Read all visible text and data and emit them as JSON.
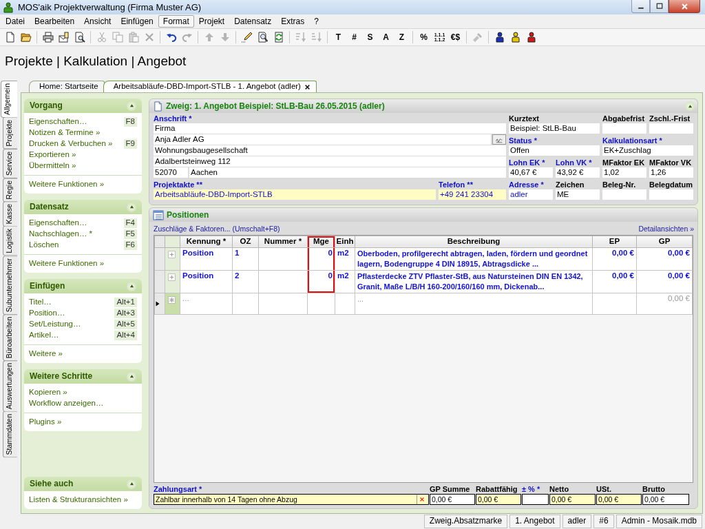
{
  "window": {
    "title": "MOS'aik Projektverwaltung (Firma Muster AG)"
  },
  "menu": [
    {
      "label": "Datei",
      "selected": false
    },
    {
      "label": "Bearbeiten",
      "selected": false
    },
    {
      "label": "Ansicht",
      "selected": false
    },
    {
      "label": "Einfügen",
      "selected": false
    },
    {
      "label": "Format",
      "selected": true
    },
    {
      "label": "Projekt",
      "selected": false
    },
    {
      "label": "Datensatz",
      "selected": false
    },
    {
      "label": "Extras",
      "selected": false
    },
    {
      "label": "?",
      "selected": false
    }
  ],
  "toolbar": [
    [
      {
        "kind": "icon",
        "disabled": false
      },
      {
        "kind": "icon",
        "disabled": false
      }
    ],
    [
      {
        "kind": "icon",
        "disabled": false
      },
      {
        "kind": "icon",
        "disabled": false
      },
      {
        "kind": "icon",
        "disabled": false
      }
    ],
    [
      {
        "kind": "icon",
        "disabled": true
      },
      {
        "kind": "icon",
        "disabled": true
      },
      {
        "kind": "icon",
        "disabled": true
      },
      {
        "kind": "icon",
        "disabled": true
      }
    ],
    [
      {
        "kind": "icon",
        "disabled": false
      },
      {
        "kind": "icon",
        "disabled": true
      }
    ],
    [
      {
        "kind": "icon",
        "disabled": true
      },
      {
        "kind": "icon",
        "disabled": true
      }
    ],
    [
      {
        "kind": "icon",
        "disabled": false
      },
      {
        "kind": "icon",
        "disabled": false
      },
      {
        "kind": "icon",
        "disabled": false
      }
    ],
    [
      {
        "kind": "icon",
        "disabled": true
      },
      {
        "kind": "icon",
        "disabled": true
      }
    ],
    [
      {
        "kind": "glyph",
        "glyph": "T",
        "disabled": false
      },
      {
        "kind": "glyph",
        "glyph": "#",
        "disabled": false
      },
      {
        "kind": "glyph",
        "glyph": "S",
        "disabled": false
      },
      {
        "kind": "glyph",
        "glyph": "A",
        "disabled": false
      },
      {
        "kind": "glyph",
        "glyph": "Z",
        "disabled": false
      }
    ],
    [
      {
        "kind": "glyph",
        "glyph": "%",
        "disabled": false
      },
      {
        "kind": "small",
        "glyph": "1.1.1 1.1.2",
        "disabled": false
      },
      {
        "kind": "glyph",
        "glyph": "€$",
        "disabled": false
      }
    ],
    [
      {
        "kind": "icon",
        "disabled": true
      }
    ],
    [
      {
        "kind": "figure",
        "disabled": false,
        "color": "#1c2fb8"
      },
      {
        "kind": "figure",
        "disabled": false,
        "color": "#e6c800"
      },
      {
        "kind": "figure",
        "disabled": false,
        "color": "#d01818"
      }
    ]
  ],
  "breadcrumb": "Projekte | Kalkulation | Angebot",
  "side_tabs": [
    {
      "label": "Allgemein",
      "selected": true
    },
    {
      "label": "Projekte",
      "selected": false
    },
    {
      "label": "Service",
      "selected": false
    },
    {
      "label": "Regie",
      "selected": false
    },
    {
      "label": "Kasse",
      "selected": false
    },
    {
      "label": "Logistik",
      "selected": false
    },
    {
      "label": "Subunternehmer",
      "selected": false
    },
    {
      "label": "Büroarbeiten",
      "selected": false
    },
    {
      "label": "Auswertungen",
      "selected": false
    },
    {
      "label": "Stammdaten",
      "selected": false
    }
  ],
  "doc_tabs": [
    {
      "label": "Home: Startseite",
      "selected": false,
      "closable": false
    },
    {
      "label": "Arbeitsabläufe-DBD-Import-STLB - 1. Angebot (adler)",
      "selected": true,
      "closable": true
    }
  ],
  "task_pane": [
    {
      "title": "Vorgang",
      "expanded": true,
      "groups": [
        [
          {
            "label": "Eigenschaften…",
            "shortcut": "F8"
          },
          {
            "label": "Notizen & Termine »"
          },
          {
            "label": "Drucken & Verbuchen »",
            "shortcut": "F9"
          },
          {
            "label": "Exportieren »"
          },
          {
            "label": "Übermitteln »"
          }
        ],
        [
          {
            "label": "Weitere Funktionen »"
          }
        ]
      ]
    },
    {
      "title": "Datensatz",
      "expanded": true,
      "groups": [
        [
          {
            "label": "Eigenschaften…",
            "shortcut": "F4"
          },
          {
            "label": "Nachschlagen… *",
            "shortcut": "F5"
          },
          {
            "label": "Löschen",
            "shortcut": "F6"
          }
        ],
        [
          {
            "label": "Weitere Funktionen »"
          }
        ]
      ]
    },
    {
      "title": "Einfügen",
      "expanded": true,
      "groups": [
        [
          {
            "label": "Titel…",
            "shortcut": "Alt+1"
          },
          {
            "label": "Position…",
            "shortcut": "Alt+3"
          },
          {
            "label": "Set/Leistung…",
            "shortcut": "Alt+5"
          },
          {
            "label": "Artikel…",
            "shortcut": "Alt+4"
          }
        ],
        [
          {
            "label": "Weitere »"
          }
        ]
      ]
    },
    {
      "title": "Weitere Schritte",
      "expanded": true,
      "groups": [
        [
          {
            "label": "Kopieren »"
          },
          {
            "label": "Workflow anzeigen…"
          }
        ],
        [
          {
            "label": "Plugins »"
          }
        ]
      ]
    },
    {
      "title": "Siehe auch",
      "expanded": true,
      "groups": [
        [
          {
            "label": "Listen & Strukturansichten »"
          }
        ]
      ]
    }
  ],
  "record": {
    "title": "Zweig: 1. Angebot Beispiel: StLB-Bau 26.05.2015 (adler)",
    "expanded": true,
    "address": {
      "label": "Anschrift *",
      "required": true,
      "lines": [
        {
          "value": "Firma",
          "has_button": false
        },
        {
          "value": "Anja Adler AG",
          "has_button": true
        },
        {
          "value": "Wohnungsbaugesellschaft",
          "has_button": false
        },
        {
          "value": "Adalbertsteinweg 112",
          "has_button": false
        }
      ],
      "zip": "52070",
      "city": "Aachen"
    },
    "project_file": {
      "label": "Projektakte **",
      "value": "Arbeitsabläufe-DBD-Import-STLB",
      "required": true,
      "linked": true,
      "highlighted": true
    },
    "phone": {
      "label": "Telefon **",
      "value": "+49 241 23304",
      "required": true,
      "linked": true,
      "highlighted": true
    },
    "fields": [
      {
        "label": "Kurztext",
        "value": "Beispiel: StLB-Bau",
        "kind": "wide",
        "required": false,
        "linked": false
      },
      {
        "label": "Abgabefrist",
        "kind": "narrow",
        "required": false,
        "linked": false
      },
      {
        "label": "Zschl.-Frist",
        "kind": "narrow",
        "required": false,
        "linked": false
      },
      {
        "label": "Status *",
        "value": "Offen",
        "kind": "wide",
        "required": true,
        "linked": false
      },
      {
        "label": "Kalkulationsart *",
        "value": "EK+Zuschlag",
        "kind": "wide",
        "required": true,
        "linked": false
      },
      {
        "label": "Lohn EK *",
        "value": "40,67 €",
        "kind": "narrow",
        "required": true,
        "linked": false
      },
      {
        "label": "Lohn VK *",
        "value": "43,92 €",
        "kind": "narrow",
        "required": true,
        "linked": false
      },
      {
        "label": "MFaktor EK",
        "value": "1,02",
        "kind": "narrow",
        "required": false,
        "linked": false
      },
      {
        "label": "MFaktor VK",
        "value": "1,26",
        "kind": "narrow",
        "required": false,
        "linked": false
      },
      {
        "label": "Adresse *",
        "value": "adler",
        "kind": "narrow",
        "required": true,
        "linked": true
      },
      {
        "label": "Zeichen",
        "value": "ME",
        "kind": "narrow",
        "required": false,
        "linked": false
      },
      {
        "label": "Beleg-Nr.",
        "kind": "narrow",
        "required": false,
        "linked": false
      },
      {
        "label": "Belegdatum",
        "kind": "narrow",
        "required": false,
        "linked": false
      }
    ]
  },
  "positions": {
    "title": "Positionen",
    "links": [
      "Zuschläge & Faktoren... (Umschalt+F8)",
      "Detailansichten »"
    ],
    "columns": [
      {
        "label": "Kennung *",
        "kind": "text",
        "highlighted": false
      },
      {
        "label": "OZ",
        "kind": "text",
        "highlighted": false
      },
      {
        "label": "Nummer *",
        "kind": "text",
        "highlighted": false
      },
      {
        "label": "Mge",
        "kind": "number",
        "highlighted": true
      },
      {
        "label": "Einh",
        "kind": "text",
        "highlighted": false
      },
      {
        "label": "Beschreibung",
        "kind": "text",
        "highlighted": false
      },
      {
        "label": "EP",
        "kind": "number",
        "highlighted": false
      },
      {
        "label": "GP",
        "kind": "number",
        "highlighted": false
      }
    ],
    "rows": [
      {
        "kind": "position",
        "current": false,
        "cells": [
          "Position",
          "1",
          null,
          "0",
          "m2",
          "Oberboden, profilgerecht abtragen, laden, fördern und geordnet lagern, Bodengruppe 4 DIN 18915, Abtragsdicke ...",
          "0,00 €",
          "0,00 €"
        ]
      },
      {
        "kind": "position",
        "current": false,
        "cells": [
          "Position",
          "2",
          null,
          "0",
          "m2",
          "Pflasterdecke ZTV Pflaster-StB, aus Natursteinen DIN EN 1342, Granit, Maße L/B/H 160-200/160/160 mm, Dickenab...",
          "0,00 €",
          "0,00 €"
        ]
      },
      {
        "kind": "new",
        "current": true,
        "cells": [
          "...",
          null,
          null,
          null,
          null,
          "...",
          null,
          "0,00 €"
        ]
      }
    ]
  },
  "totals": {
    "payment": {
      "label": "Zahlungsart *",
      "value": "Zahlbar innerhalb von 14 Tagen ohne Abzug",
      "required": true,
      "highlighted": true
    },
    "fields": [
      {
        "label": "GP Summe",
        "value": "0,00 €",
        "required": false,
        "highlighted": false
      },
      {
        "label": "Rabattfähig",
        "value": "0,00 €",
        "required": false,
        "highlighted": true
      },
      {
        "label": "± % *",
        "required": true,
        "highlighted": false
      },
      {
        "label": "Netto",
        "value": "0,00 €",
        "required": false,
        "highlighted": true
      },
      {
        "label": "USt.",
        "value": "0,00 €",
        "required": false,
        "highlighted": true
      },
      {
        "label": "Brutto",
        "value": "0,00 €",
        "required": false,
        "highlighted": false
      }
    ]
  },
  "status_bar": [
    "Zweig.Absatzmarke",
    "1. Angebot",
    "adler",
    "#6",
    "Admin - Mosaik.mdb"
  ]
}
